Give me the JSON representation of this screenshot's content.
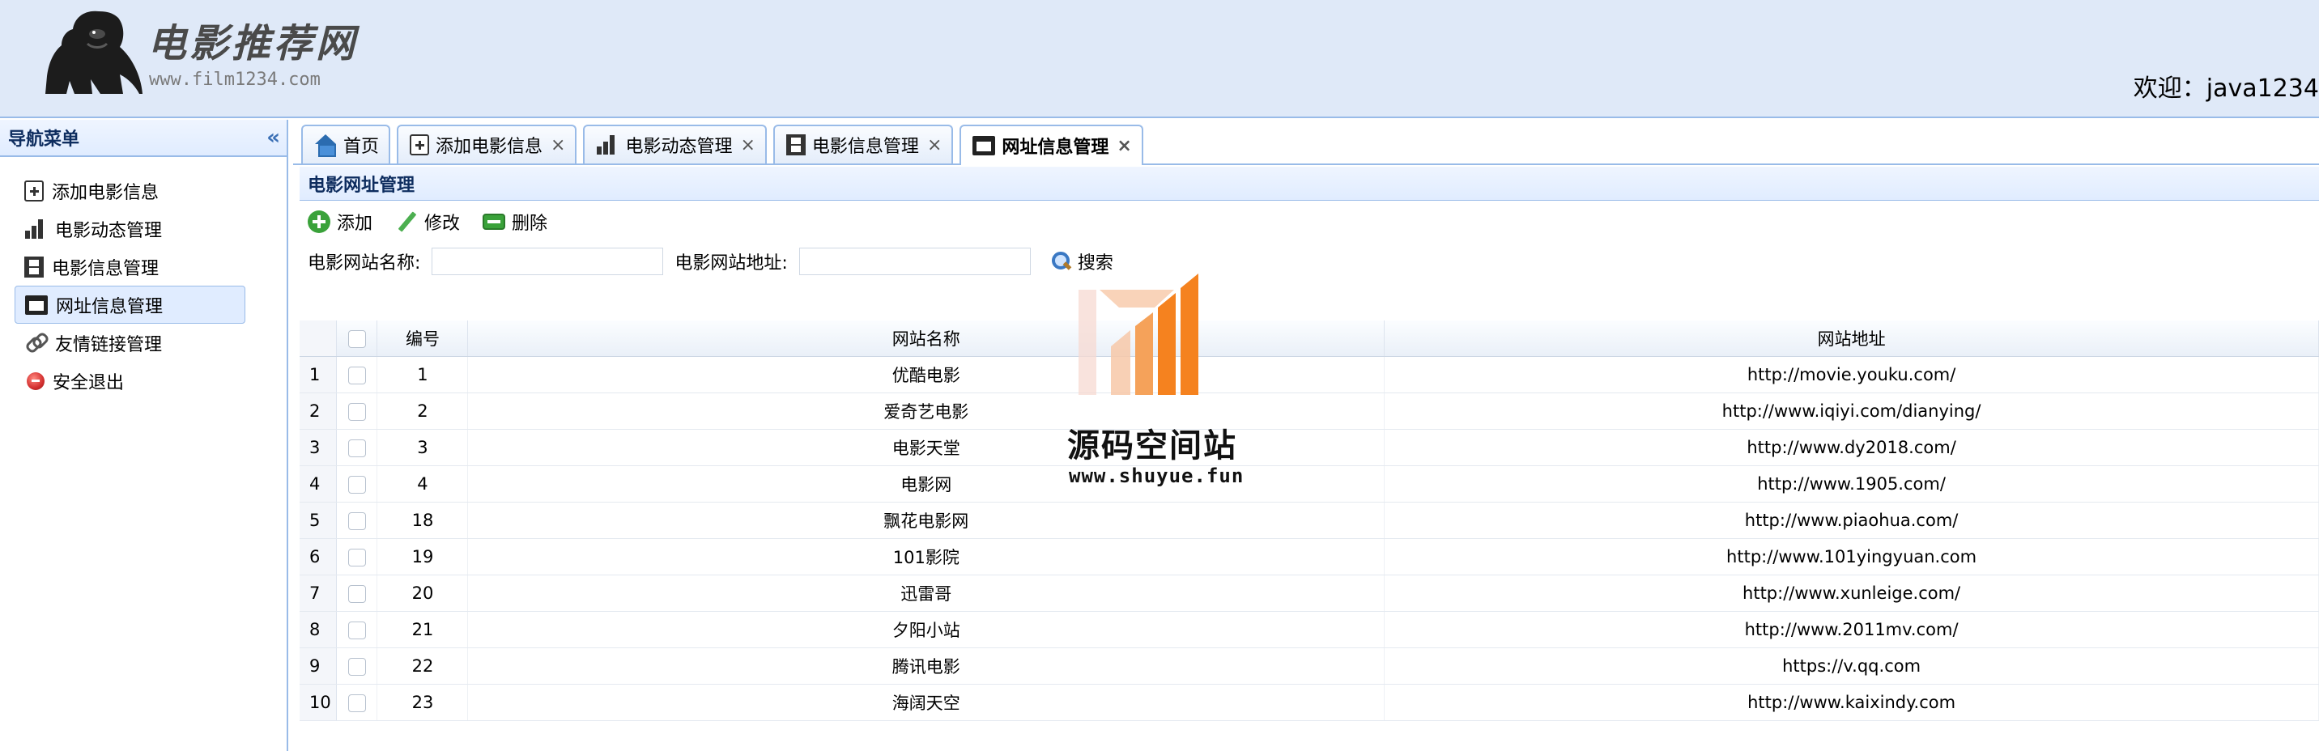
{
  "header": {
    "logo_title": "电影推荐网",
    "logo_url": "www.film1234.com",
    "welcome": "欢迎：java1234"
  },
  "nav": {
    "title": "导航菜单",
    "collapse_glyph": "«",
    "items": [
      {
        "label": "添加电影信息",
        "icon": "add-icon"
      },
      {
        "label": "电影动态管理",
        "icon": "bar-chart-icon"
      },
      {
        "label": "电影信息管理",
        "icon": "film-icon"
      },
      {
        "label": "网址信息管理",
        "icon": "website-icon",
        "active": true
      },
      {
        "label": "友情链接管理",
        "icon": "link-icon"
      },
      {
        "label": "安全退出",
        "icon": "exit-icon"
      }
    ]
  },
  "tabs": [
    {
      "label": "首页",
      "icon": "home-icon",
      "closable": false
    },
    {
      "label": "添加电影信息",
      "icon": "add-icon",
      "closable": true
    },
    {
      "label": "电影动态管理",
      "icon": "bar-chart-icon",
      "closable": true
    },
    {
      "label": "电影信息管理",
      "icon": "film-icon",
      "closable": true
    },
    {
      "label": "网址信息管理",
      "icon": "website-icon",
      "closable": true,
      "active": true
    }
  ],
  "tab_close_glyph": "×",
  "panel": {
    "title": "电影网址管理",
    "toolbar": {
      "add": "添加",
      "edit": "修改",
      "delete": "删除"
    },
    "search": {
      "name_label": "电影网站名称:",
      "name_value": "",
      "url_label": "电影网站地址:",
      "url_value": "",
      "button": "搜索"
    },
    "grid": {
      "columns": [
        "编号",
        "网站名称",
        "网站地址"
      ],
      "rows": [
        {
          "rownum": "1",
          "id": "1",
          "name": "优酷电影",
          "url": "http://movie.youku.com/"
        },
        {
          "rownum": "2",
          "id": "2",
          "name": "爱奇艺电影",
          "url": "http://www.iqiyi.com/dianying/"
        },
        {
          "rownum": "3",
          "id": "3",
          "name": "电影天堂",
          "url": "http://www.dy2018.com/"
        },
        {
          "rownum": "4",
          "id": "4",
          "name": "电影网",
          "url": "http://www.1905.com/"
        },
        {
          "rownum": "5",
          "id": "18",
          "name": "飘花电影网",
          "url": "http://www.piaohua.com/"
        },
        {
          "rownum": "6",
          "id": "19",
          "name": "101影院",
          "url": "http://www.101yingyuan.com"
        },
        {
          "rownum": "7",
          "id": "20",
          "name": "迅雷哥",
          "url": "http://www.xunleige.com/"
        },
        {
          "rownum": "8",
          "id": "21",
          "name": "夕阳小站",
          "url": "http://www.2011mv.com/"
        },
        {
          "rownum": "9",
          "id": "22",
          "name": "腾讯电影",
          "url": "https://v.qq.com"
        },
        {
          "rownum": "10",
          "id": "23",
          "name": "海阔天空",
          "url": "http://www.kaixindy.com"
        }
      ]
    }
  },
  "watermark": {
    "text": "源码空间站",
    "url": "www.shuyue.fun"
  },
  "colors": {
    "header_bg": "#dfe9f8",
    "border": "#99bbe8",
    "panel_title": "#0e2d5f",
    "watermark_orange": "#f5821f"
  }
}
